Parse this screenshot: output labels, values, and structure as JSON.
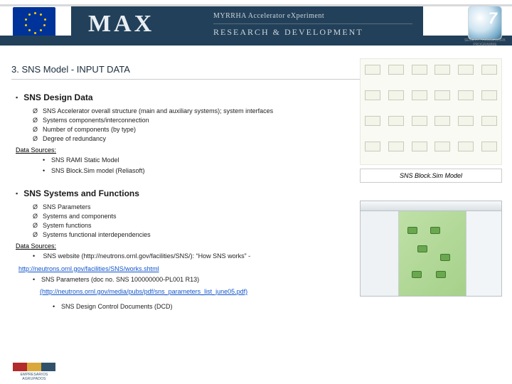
{
  "header": {
    "logo_text": "MAX",
    "title_small": "MYRRHA Accelerator eXperiment",
    "subtitle": "RESEARCH & DEVELOPMENT PROGRAMME",
    "fp7_caption": "SEVENTH FRAMEWORK PROGRAMME"
  },
  "page_title": "3. SNS Model - INPUT DATA",
  "section1": {
    "heading": "SNS Design Data",
    "bullets": [
      "SNS Accelerator overall structure (main and auxiliary systems); system interfaces",
      "Systems components/interconnection",
      "Number of components (by type)",
      "Degree of redundancy"
    ],
    "sources_label": "Data Sources:",
    "sources": [
      "SNS RAMI Static Model",
      "SNS Block.Sim model (Reliasoft)"
    ]
  },
  "caption": "SNS Block.Sim Model",
  "section2": {
    "heading": "SNS Systems and Functions",
    "bullets": [
      "SNS Parameters",
      "Systems and components",
      "System functions",
      "Systems functional interdependencies"
    ],
    "sources_label": "Data Sources:",
    "src_line1_a": "SNS website (http://neutrons.ornl.gov/facilities/SNS/): “How SNS works” - ",
    "src_line1_link": "http://neutrons.ornl.gov/facilities/SNS/works.shtml",
    "src_line2_a": "SNS Parameters (doc no. SNS 100000000-PL001 R13)",
    "src_line2_link": "(http://neutrons.ornl.gov/media/pubs/pdf/sns_parameters_list_june05.pdf)",
    "src_line3": "SNS Design Control Documents (DCD)"
  },
  "footer_logo_text": "EMPRESARIOS AGRUPADOS"
}
